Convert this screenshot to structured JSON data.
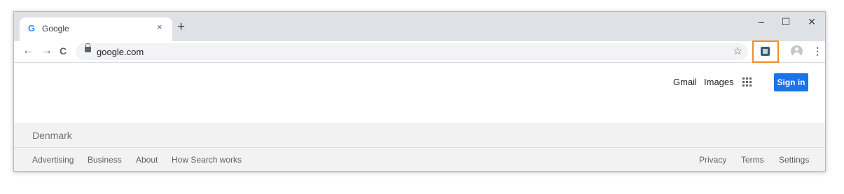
{
  "browser": {
    "tab": {
      "favicon": "G",
      "title": "Google",
      "close": "×"
    },
    "new_tab": "+",
    "window_controls": {
      "minimize": "–",
      "maximize": "☐",
      "close": "✕"
    },
    "nav": {
      "back": "←",
      "forward": "→",
      "reload": "C"
    },
    "address": {
      "url": "google.com",
      "lock_icon": "lock-icon"
    },
    "bookmark_star": "☆",
    "extension_icon": "extension-icon",
    "menu": "⋮",
    "highlight_color": "#f28c28"
  },
  "page": {
    "top_links": {
      "gmail": "Gmail",
      "images": "Images"
    },
    "apps_icon": "apps-grid-icon",
    "signin": "Sign in",
    "signin_color": "#1a73e8",
    "country": "Denmark",
    "footer_left": [
      "Advertising",
      "Business",
      "About",
      "How Search works"
    ],
    "footer_right": [
      "Privacy",
      "Terms",
      "Settings"
    ]
  }
}
